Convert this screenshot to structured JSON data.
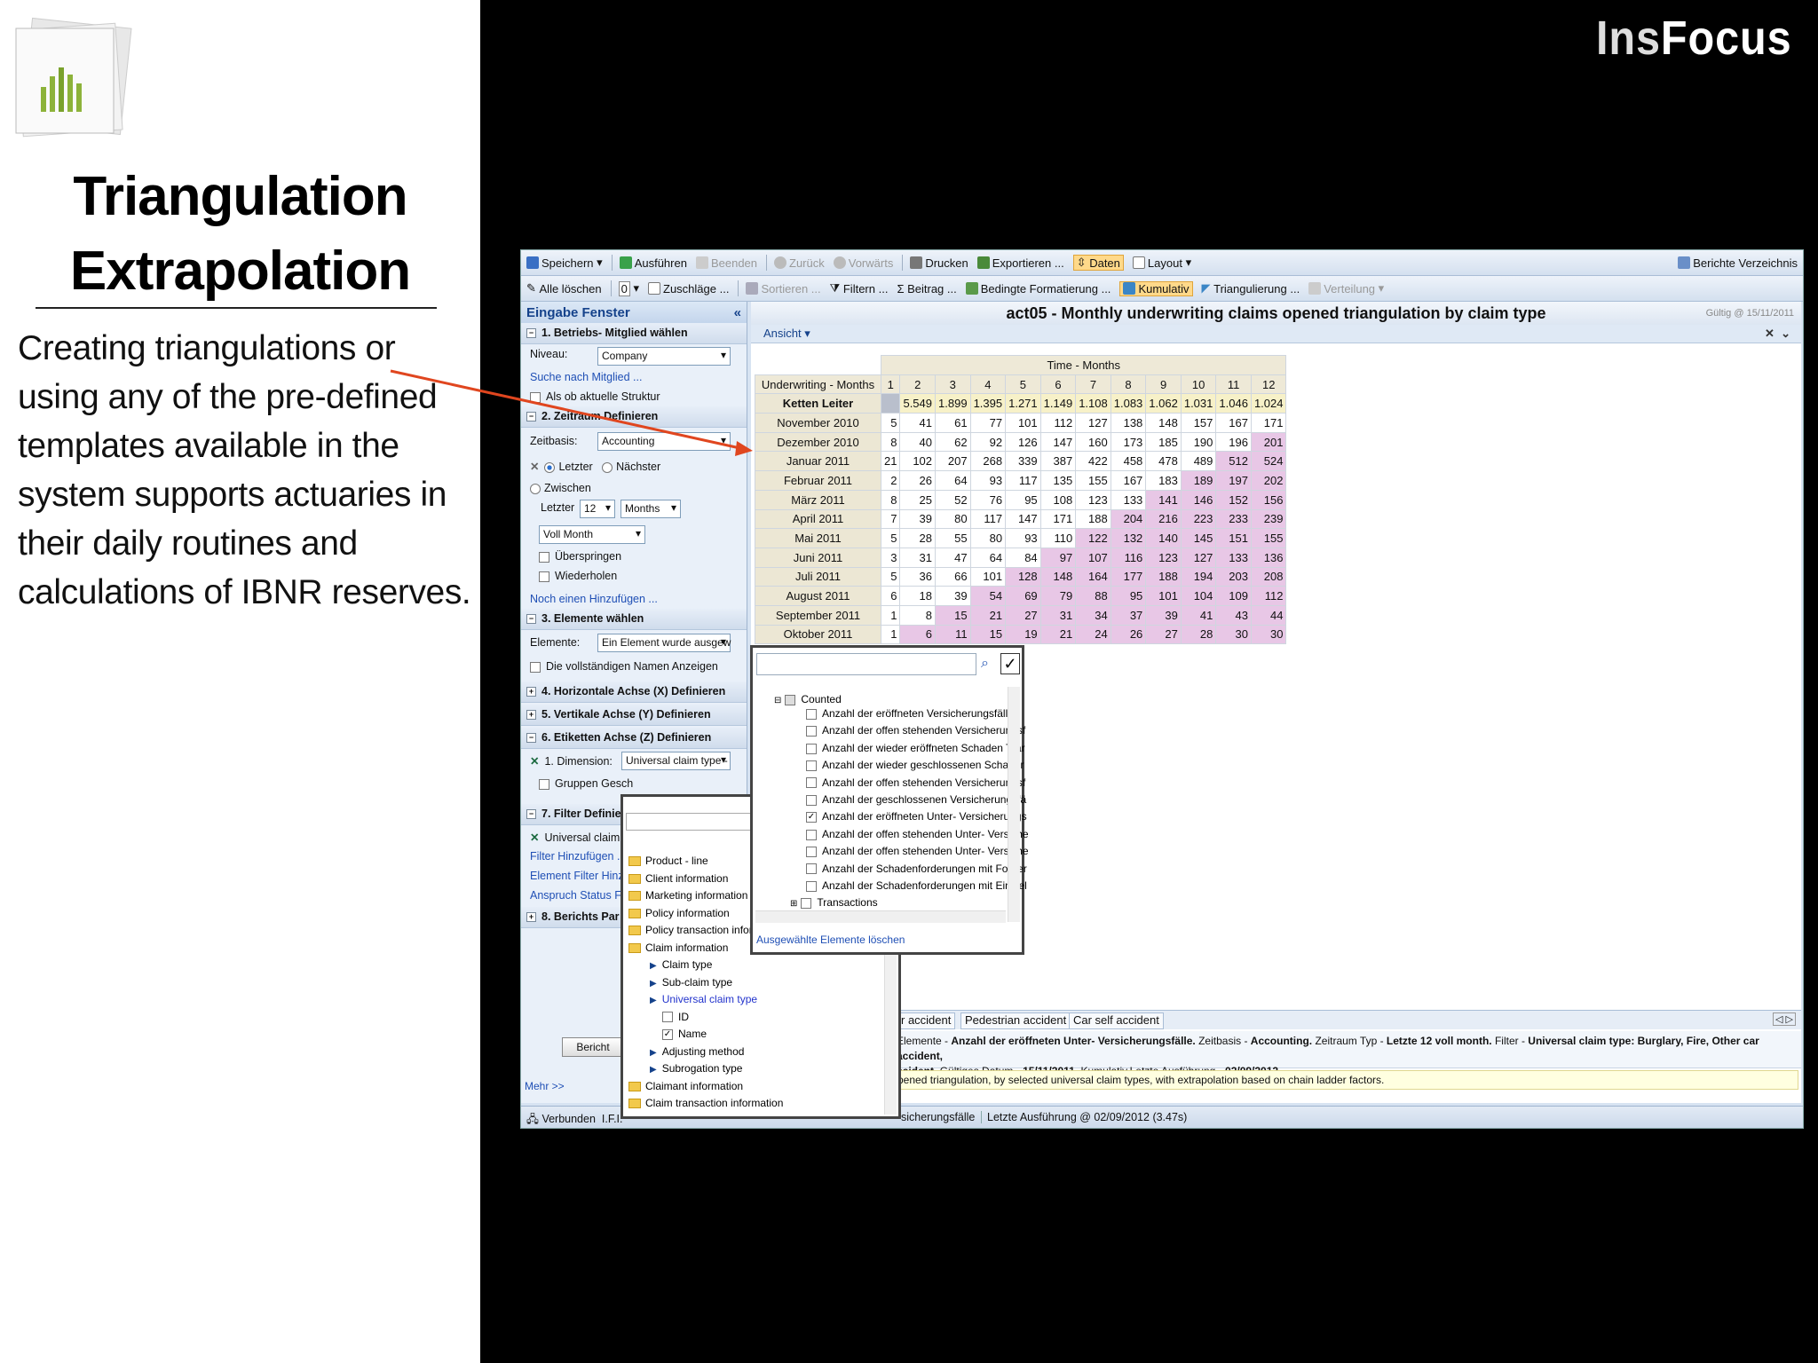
{
  "slide": {
    "title_line1": "Triangulation",
    "title_line2": "Extrapolation",
    "body": "Creating triangulations or using any of the pre-defined templates available in the system supports actuaries in their daily routines and calculations of IBNR reserves.",
    "brand_part1": "Ins",
    "brand_part2": "Focus"
  },
  "toolbar1": {
    "speichern": "Speichern",
    "ausfuehren": "Ausführen",
    "beenden": "Beenden",
    "zurueck": "Zurück",
    "vorwaerts": "Vorwärts",
    "drucken": "Drucken",
    "exportieren": "Exportieren ...",
    "daten": "Daten",
    "layout": "Layout",
    "berichte": "Berichte Verzeichnis"
  },
  "toolbar2": {
    "alle_loeschen": "Alle löschen",
    "zero": "0",
    "zuschlaege": "Zuschläge ...",
    "sortieren": "Sortieren ...",
    "filtern": "Filtern ...",
    "beitrag": "Beitrag ...",
    "bedingte": "Bedingte Formatierung ...",
    "kumulativ": "Kumulativ",
    "triangulierung": "Triangulierung ...",
    "verteilung": "Verteilung"
  },
  "left_panel": {
    "header": "Eingabe Fenster",
    "s1": "1. Betriebs- Mitglied wählen",
    "niveau_label": "Niveau:",
    "niveau_value": "Company",
    "suche": "Suche nach Mitglied ...",
    "als_ob": "Als ob aktuelle Struktur",
    "s2": "2. Zeitraum Definieren",
    "zeitbasis_label": "Zeitbasis:",
    "zeitbasis_value": "Accounting",
    "letzter": "Letzter",
    "naechster": "Nächster",
    "zwischen": "Zwischen",
    "letzter_label": "Letzter",
    "letzter_num": "12",
    "months": "Months",
    "voll_month": "Voll Month",
    "ueberspringen": "Überspringen",
    "wiederholen": "Wiederholen",
    "noch_einen": "Noch einen Hinzufügen ...",
    "s3": "3. Elemente wählen",
    "elemente_label": "Elemente:",
    "elemente_value": "Ein Element wurde ausgew",
    "vollstaendig": "Die vollständigen Namen Anzeigen",
    "s4": "4. Horizontale Achse (X) Definieren",
    "s5": "5. Vertikale Achse (Y) Definieren",
    "s6": "6. Etiketten Achse (Z) Definieren",
    "dimension_label": "1. Dimension:",
    "dimension_value": "Universal claim type -",
    "gruppen": "Gruppen Gesch",
    "s7": "7. Filter Definier",
    "universal_claim": "Universal claim",
    "filter_hinzu": "Filter Hinzufügen ...",
    "element_filter": "Element Filter Hinzufü",
    "anspruch": "Anspruch Status Filter",
    "s8": "8. Berichts Par",
    "bericht_btn": "Bericht",
    "mehr": "Mehr >>"
  },
  "report": {
    "title": "act05 - Monthly underwriting claims opened triangulation by claim type",
    "valid": "Gültig @ 15/11/2011",
    "ansicht": "Ansicht",
    "time_header": "Time - Months",
    "row_header": "Underwriting - Months",
    "columns": [
      "1",
      "2",
      "3",
      "4",
      "5",
      "6",
      "7",
      "8",
      "9",
      "10",
      "11",
      "12"
    ],
    "rows": [
      {
        "label": "Ketten Leiter",
        "values": [
          "",
          "5.549",
          "1.899",
          "1.395",
          "1.271",
          "1.149",
          "1.108",
          "1.083",
          "1.062",
          "1.031",
          "1.046",
          "1.024"
        ]
      },
      {
        "label": "November 2010",
        "values": [
          "5",
          "41",
          "61",
          "77",
          "101",
          "112",
          "127",
          "138",
          "148",
          "157",
          "167",
          "171"
        ]
      },
      {
        "label": "Dezember 2010",
        "values": [
          "8",
          "40",
          "62",
          "92",
          "126",
          "147",
          "160",
          "173",
          "185",
          "190",
          "196",
          "201"
        ]
      },
      {
        "label": "Januar 2011",
        "values": [
          "21",
          "102",
          "207",
          "268",
          "339",
          "387",
          "422",
          "458",
          "478",
          "489",
          "512",
          "524"
        ]
      },
      {
        "label": "Februar 2011",
        "values": [
          "2",
          "26",
          "64",
          "93",
          "117",
          "135",
          "155",
          "167",
          "183",
          "189",
          "197",
          "202"
        ]
      },
      {
        "label": "März 2011",
        "values": [
          "8",
          "25",
          "52",
          "76",
          "95",
          "108",
          "123",
          "133",
          "141",
          "146",
          "152",
          "156"
        ]
      },
      {
        "label": "April 2011",
        "values": [
          "7",
          "39",
          "80",
          "117",
          "147",
          "171",
          "188",
          "204",
          "216",
          "223",
          "233",
          "239"
        ]
      },
      {
        "label": "Mai 2011",
        "values": [
          "5",
          "28",
          "55",
          "80",
          "93",
          "110",
          "122",
          "132",
          "140",
          "145",
          "151",
          "155"
        ]
      },
      {
        "label": "Juni 2011",
        "values": [
          "3",
          "31",
          "47",
          "64",
          "84",
          "97",
          "107",
          "116",
          "123",
          "127",
          "133",
          "136"
        ]
      },
      {
        "label": "Juli 2011",
        "values": [
          "5",
          "36",
          "66",
          "101",
          "128",
          "148",
          "164",
          "177",
          "188",
          "194",
          "203",
          "208"
        ]
      },
      {
        "label": "August 2011",
        "values": [
          "6",
          "18",
          "39",
          "54",
          "69",
          "79",
          "88",
          "95",
          "101",
          "104",
          "109",
          "112"
        ]
      },
      {
        "label": "September 2011",
        "values": [
          "1",
          "8",
          "15",
          "21",
          "27",
          "31",
          "34",
          "37",
          "39",
          "41",
          "43",
          "44"
        ]
      },
      {
        "label": "Oktober 2011",
        "values": [
          "1",
          "6",
          "11",
          "15",
          "19",
          "21",
          "24",
          "26",
          "27",
          "28",
          "30",
          "30"
        ]
      }
    ],
    "tabs": [
      "r accident",
      "Pedestrian accident",
      "Car self accident"
    ],
    "info_line1_a": "Elemente - ",
    "info_line1_b": "Anzahl der eröffneten Unter- Versicherungsfälle.",
    "info_line1_c": " Zeitbasis - ",
    "info_line1_d": "Accounting.",
    "info_line1_e": " Zeitraum Typ - ",
    "info_line1_f": "Letzte 12 voll month.",
    "info_line1_g": " Filter - ",
    "info_line1_h": "Universal claim type: Burglary, Fire, Other car accident,",
    "info_line2_a": "ccident.",
    "info_line2_b": " Gültiges Datum - ",
    "info_line2_c": "15/11/2011.",
    "info_line2_d": " Kumulativ.Letzte Ausführung - ",
    "info_line2_e": "02/09/2012.",
    "description": "pened triangulation, by selected universal claim types, with extrapolation based on chain ladder factors."
  },
  "status": {
    "verbunden": "Verbunden",
    "ifi": "I.F.I.",
    "mid": "sicherungsfälle",
    "last": "Letzte Ausführung @ 02/09/2012 (3.47s)"
  },
  "dim_popup": {
    "items": [
      {
        "type": "folder",
        "label": "Product - line"
      },
      {
        "type": "folder",
        "label": "Client information"
      },
      {
        "type": "folder",
        "label": "Marketing information"
      },
      {
        "type": "folder",
        "label": "Policy information"
      },
      {
        "type": "folder",
        "label": "Policy transaction inform"
      },
      {
        "type": "folder-open",
        "label": "Claim information"
      },
      {
        "type": "child",
        "label": "Claim type"
      },
      {
        "type": "child",
        "label": "Sub-claim type"
      },
      {
        "type": "child-sel",
        "label": "Universal claim type"
      },
      {
        "type": "check",
        "label": "ID"
      },
      {
        "type": "check-on",
        "label": "Name"
      },
      {
        "type": "child",
        "label": "Adjusting method"
      },
      {
        "type": "child",
        "label": "Subrogation type"
      },
      {
        "type": "folder",
        "label": "Claimant information"
      },
      {
        "type": "folder",
        "label": "Claim transaction information"
      }
    ]
  },
  "elem_popup": {
    "root": "Counted",
    "items": [
      {
        "checked": false,
        "label": "Anzahl der eröffneten Versicherungsfälle"
      },
      {
        "checked": false,
        "label": "Anzahl der offen stehenden Versicherungsf"
      },
      {
        "checked": false,
        "label": "Anzahl der wieder eröffneten Schaden Trar"
      },
      {
        "checked": false,
        "label": "Anzahl der wieder geschlossenen Schader"
      },
      {
        "checked": false,
        "label": "Anzahl der offen stehenden Versicherungsf"
      },
      {
        "checked": false,
        "label": "Anzahl der geschlossenen Versicherungsfä"
      },
      {
        "checked": true,
        "label": "Anzahl der eröffneten Unter- Versicherungs"
      },
      {
        "checked": false,
        "label": "Anzahl der offen stehenden Unter- Versiche"
      },
      {
        "checked": false,
        "label": "Anzahl der offen stehenden Unter- Versiche"
      },
      {
        "checked": false,
        "label": "Anzahl der Schadenforderungen mit Forder"
      },
      {
        "checked": false,
        "label": "Anzahl der Schadenforderungen mit Einziel"
      }
    ],
    "transactions": "Transactions",
    "delete_link": "Ausgewählte Elemente löschen"
  }
}
